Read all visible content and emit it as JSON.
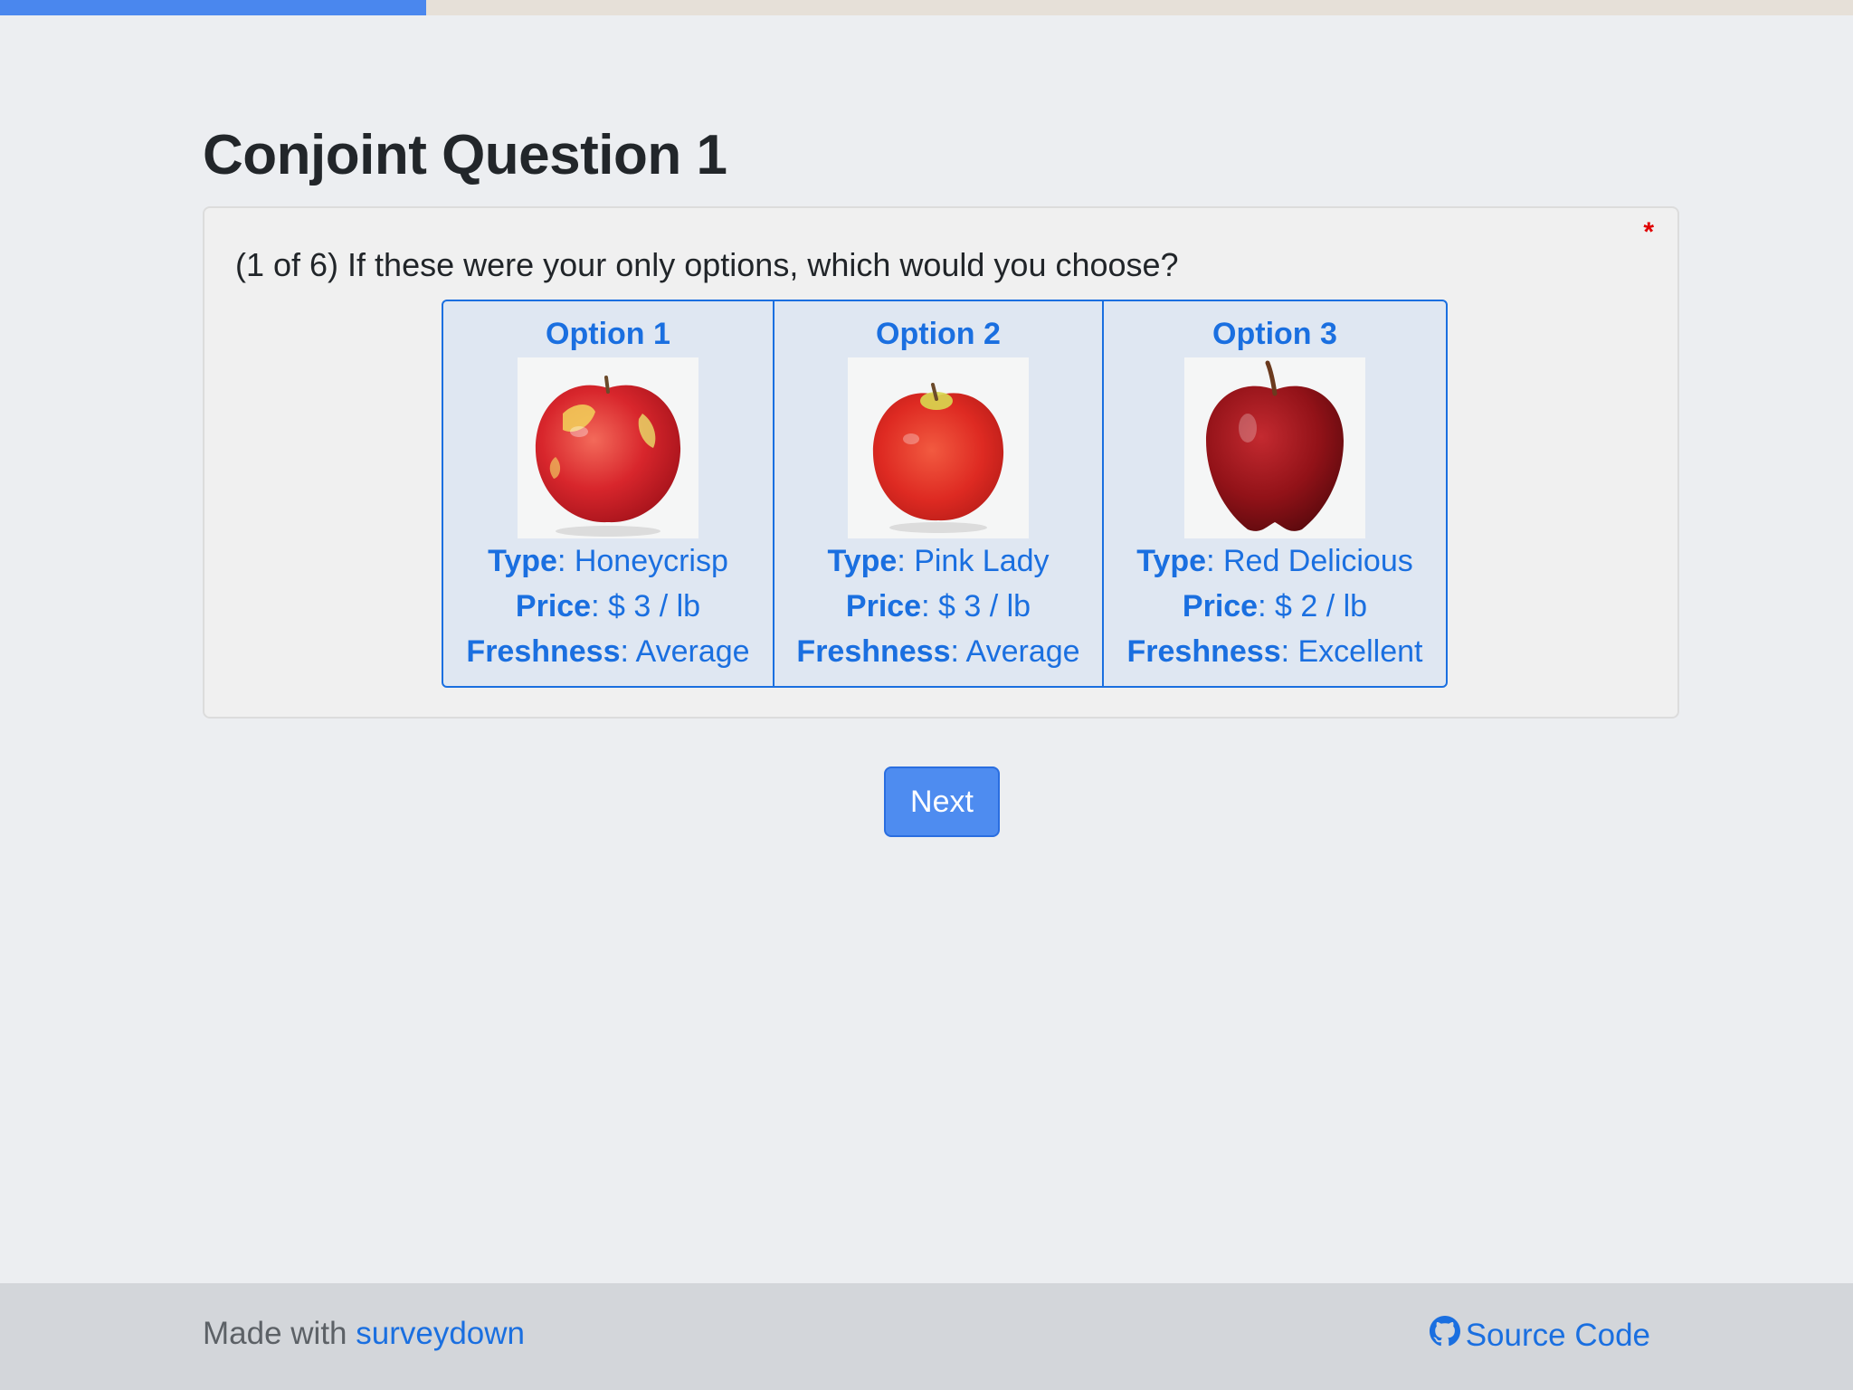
{
  "progress": {
    "fraction": 0.23
  },
  "page": {
    "title": "Conjoint Question 1"
  },
  "question": {
    "text": "(1 of 6) If these were your only options, which would you choose?",
    "required_marker": "*"
  },
  "options": [
    {
      "title": "Option 1",
      "image": "honeycrisp-apple",
      "type_label": "Type",
      "type_value": ": Honeycrisp",
      "price_label": "Price",
      "price_value": ": $ 3 / lb",
      "freshness_label": "Freshness",
      "freshness_value": ": Average"
    },
    {
      "title": "Option 2",
      "image": "pink-lady-apple",
      "type_label": "Type",
      "type_value": ": Pink Lady",
      "price_label": "Price",
      "price_value": ": $ 3 / lb",
      "freshness_label": "Freshness",
      "freshness_value": ": Average"
    },
    {
      "title": "Option 3",
      "image": "red-delicious-apple",
      "type_label": "Type",
      "type_value": ": Red Delicious",
      "price_label": "Price",
      "price_value": ": $ 2 / lb",
      "freshness_label": "Freshness",
      "freshness_value": ": Excellent"
    }
  ],
  "navigation": {
    "next_label": "Next"
  },
  "footer": {
    "made_with": "Made with ",
    "made_with_link": "surveydown",
    "source_label": "Source Code",
    "source_icon": "github-icon"
  },
  "colors": {
    "accent": "#1a6fe0",
    "button": "#4e8cf0",
    "progress": "#4a87ee",
    "required": "#e00000"
  }
}
